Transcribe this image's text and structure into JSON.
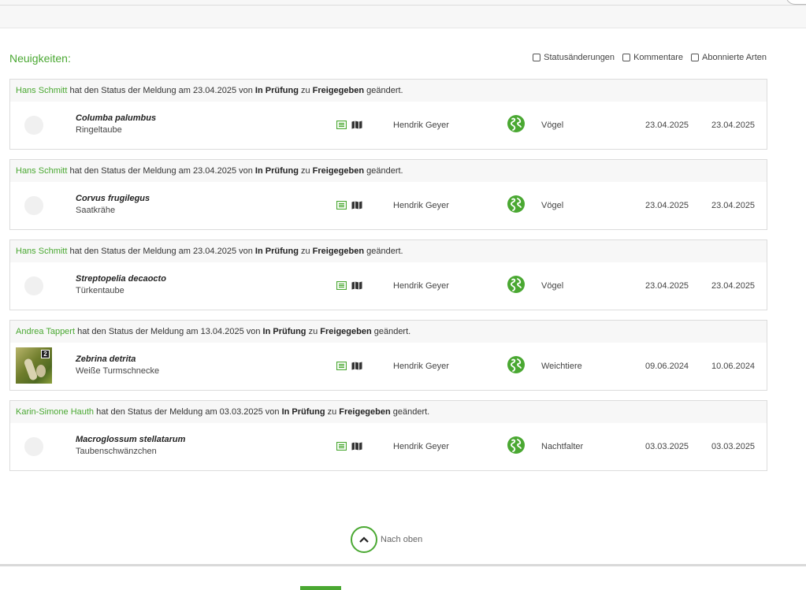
{
  "heading": "Neuigkeiten:",
  "filters": [
    {
      "label": "Statusänderungen",
      "checked": false
    },
    {
      "label": "Kommentare",
      "checked": false
    },
    {
      "label": "Abonnierte Arten",
      "checked": false
    }
  ],
  "feed": [
    {
      "user": "Hans Schmitt",
      "text1": " hat den Status der Meldung am 23.04.2025 von ",
      "from": "In Prüfung",
      "text2": " zu ",
      "to": "Freigegeben",
      "text3": " geändert.",
      "has_photo": false,
      "photo_count": "",
      "sci": "Columba palumbus",
      "common": "Ringeltaube",
      "observer": "Hendrik Geyer",
      "group": "Vögel",
      "date1": "23.04.2025",
      "date2": "23.04.2025"
    },
    {
      "user": "Hans Schmitt",
      "text1": " hat den Status der Meldung am 23.04.2025 von ",
      "from": "In Prüfung",
      "text2": " zu ",
      "to": "Freigegeben",
      "text3": " geändert.",
      "has_photo": false,
      "photo_count": "",
      "sci": "Corvus frugilegus",
      "common": "Saatkrähe",
      "observer": "Hendrik Geyer",
      "group": "Vögel",
      "date1": "23.04.2025",
      "date2": "23.04.2025"
    },
    {
      "user": "Hans Schmitt",
      "text1": " hat den Status der Meldung am 23.04.2025 von ",
      "from": "In Prüfung",
      "text2": " zu ",
      "to": "Freigegeben",
      "text3": " geändert.",
      "has_photo": false,
      "photo_count": "",
      "sci": "Streptopelia decaocto",
      "common": "Türkentaube",
      "observer": "Hendrik Geyer",
      "group": "Vögel",
      "date1": "23.04.2025",
      "date2": "23.04.2025"
    },
    {
      "user": "Andrea Tappert",
      "text1": " hat den Status der Meldung am 13.04.2025 von ",
      "from": "In Prüfung",
      "text2": " zu ",
      "to": "Freigegeben",
      "text3": " geändert.",
      "has_photo": true,
      "photo_count": "2",
      "sci": "Zebrina detrita",
      "common": "Weiße Turmschnecke",
      "observer": "Hendrik Geyer",
      "group": "Weichtiere",
      "date1": "09.06.2024",
      "date2": "10.06.2024"
    },
    {
      "user": "Karin-Simone Hauth",
      "text1": " hat den Status der Meldung am 03.03.2025 von ",
      "from": "In Prüfung",
      "text2": " zu ",
      "to": "Freigegeben",
      "text3": " geändert.",
      "has_photo": false,
      "photo_count": "",
      "sci": "Macroglossum stellatarum",
      "common": "Taubenschwänzchen",
      "observer": "Hendrik Geyer",
      "group": "Nachtfalter",
      "date1": "03.03.2025",
      "date2": "03.03.2025"
    }
  ],
  "icons": {
    "details": "list-icon",
    "map": "map-icon",
    "group": "globe-icon"
  },
  "colors": {
    "accent": "#4aa832"
  },
  "back_to_top": "Nach oben"
}
